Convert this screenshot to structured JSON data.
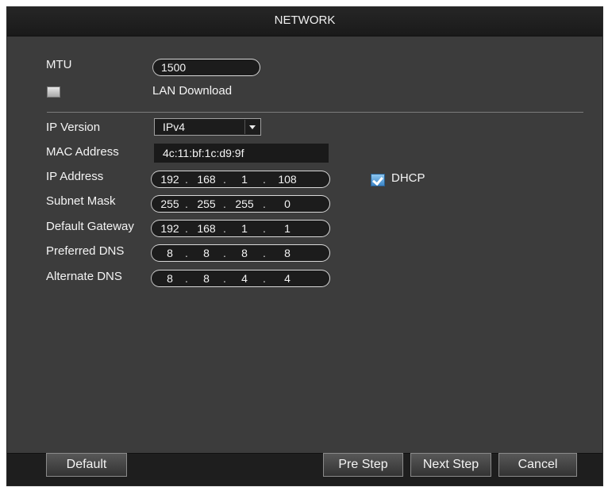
{
  "window": {
    "title": "NETWORK"
  },
  "mtu": {
    "label": "MTU",
    "value": "1500"
  },
  "lan_download": {
    "label": "LAN Download",
    "checked": false
  },
  "ip_version": {
    "label": "IP Version",
    "selected": "IPv4"
  },
  "mac_address": {
    "label": "MAC Address",
    "value": "4c:11:bf:1c:d9:9f"
  },
  "ip_address": {
    "label": "IP Address",
    "octets": [
      "192",
      "168",
      "1",
      "108"
    ]
  },
  "dhcp": {
    "label": "DHCP",
    "checked": true
  },
  "subnet_mask": {
    "label": "Subnet Mask",
    "octets": [
      "255",
      "255",
      "255",
      "0"
    ]
  },
  "default_gateway": {
    "label": "Default Gateway",
    "octets": [
      "192",
      "168",
      "1",
      "1"
    ]
  },
  "preferred_dns": {
    "label": "Preferred DNS",
    "octets": [
      "8",
      "8",
      "8",
      "8"
    ]
  },
  "alternate_dns": {
    "label": "Alternate DNS",
    "octets": [
      "8",
      "8",
      "4",
      "4"
    ]
  },
  "footer": {
    "default_label": "Default",
    "pre_step_label": "Pre Step",
    "next_step_label": "Next Step",
    "cancel_label": "Cancel"
  }
}
